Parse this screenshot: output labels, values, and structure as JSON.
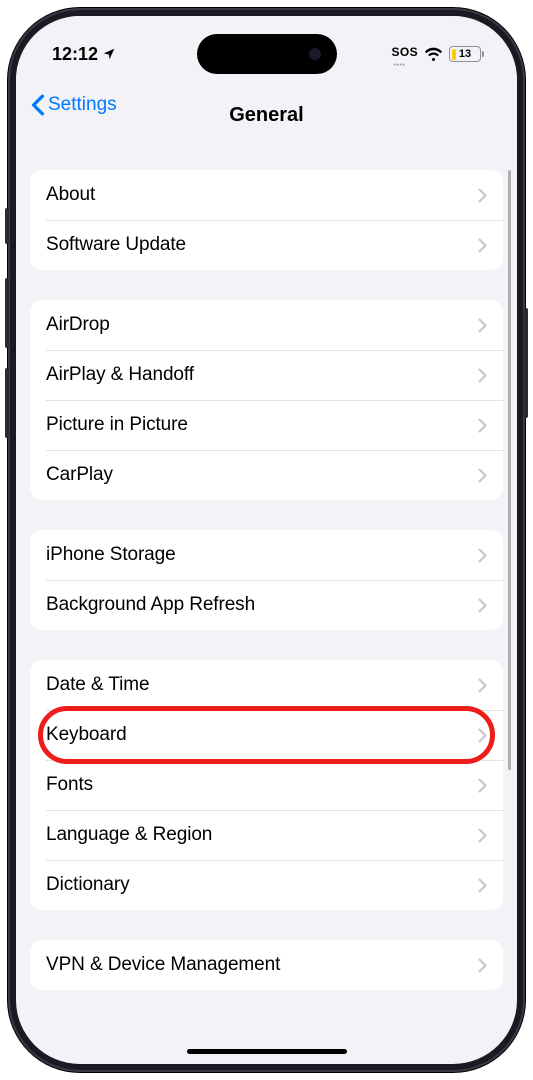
{
  "status": {
    "time": "12:12",
    "sos": "SOS",
    "battery": "13"
  },
  "nav": {
    "back": "Settings",
    "title": "General"
  },
  "groups": [
    {
      "id": "g1",
      "items": [
        {
          "id": "about",
          "label": "About"
        },
        {
          "id": "software-update",
          "label": "Software Update"
        }
      ]
    },
    {
      "id": "g2",
      "items": [
        {
          "id": "airdrop",
          "label": "AirDrop"
        },
        {
          "id": "airplay-handoff",
          "label": "AirPlay & Handoff"
        },
        {
          "id": "picture-in-picture",
          "label": "Picture in Picture"
        },
        {
          "id": "carplay",
          "label": "CarPlay"
        }
      ]
    },
    {
      "id": "g3",
      "items": [
        {
          "id": "iphone-storage",
          "label": "iPhone Storage"
        },
        {
          "id": "background-app-refresh",
          "label": "Background App Refresh"
        }
      ]
    },
    {
      "id": "g4",
      "items": [
        {
          "id": "date-time",
          "label": "Date & Time"
        },
        {
          "id": "keyboard",
          "label": "Keyboard",
          "highlighted": true
        },
        {
          "id": "fonts",
          "label": "Fonts"
        },
        {
          "id": "language-region",
          "label": "Language & Region"
        },
        {
          "id": "dictionary",
          "label": "Dictionary"
        }
      ]
    },
    {
      "id": "g5",
      "items": [
        {
          "id": "vpn-device-management",
          "label": "VPN & Device Management"
        }
      ]
    }
  ]
}
